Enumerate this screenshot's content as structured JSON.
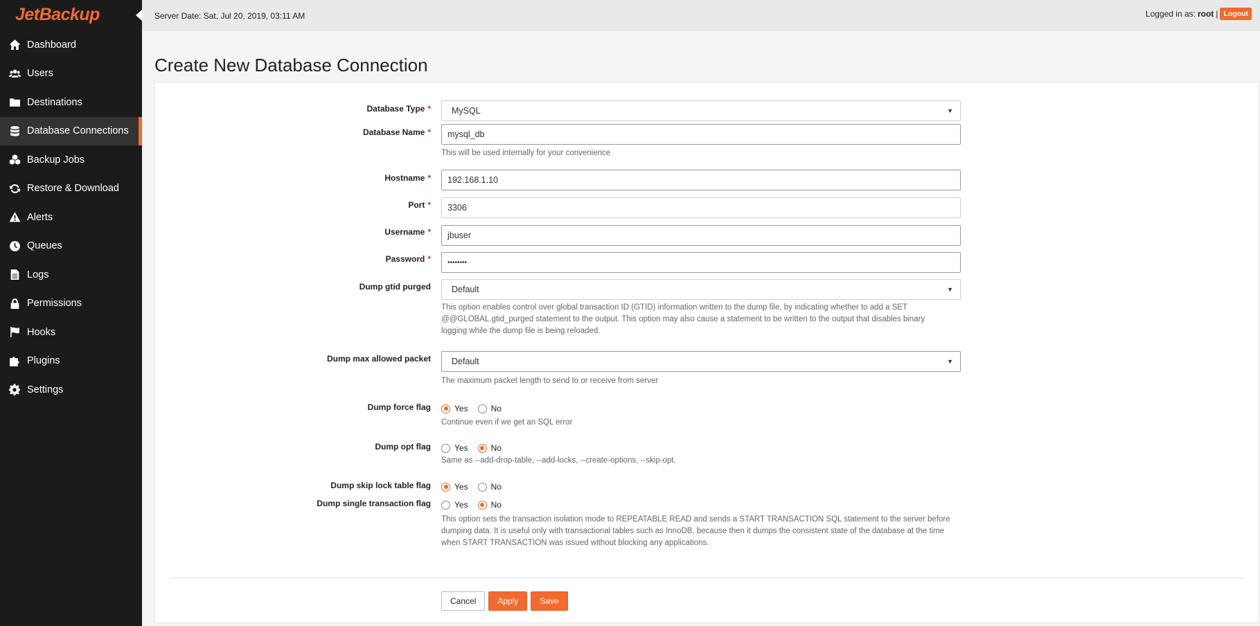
{
  "brand": {
    "name": "JetBackup",
    "accent": "#f26a2e"
  },
  "sidebar": {
    "items": [
      {
        "label": "Dashboard",
        "icon": "home-icon"
      },
      {
        "label": "Users",
        "icon": "users-icon"
      },
      {
        "label": "Destinations",
        "icon": "folder-icon"
      },
      {
        "label": "Database Connections",
        "icon": "database-icon",
        "active": true
      },
      {
        "label": "Backup Jobs",
        "icon": "cubes-icon"
      },
      {
        "label": "Restore & Download",
        "icon": "refresh-icon"
      },
      {
        "label": "Alerts",
        "icon": "warning-icon"
      },
      {
        "label": "Queues",
        "icon": "clock-icon"
      },
      {
        "label": "Logs",
        "icon": "file-icon"
      },
      {
        "label": "Permissions",
        "icon": "lock-icon"
      },
      {
        "label": "Hooks",
        "icon": "flag-icon"
      },
      {
        "label": "Plugins",
        "icon": "puzzle-icon"
      },
      {
        "label": "Settings",
        "icon": "gear-icon"
      }
    ]
  },
  "header": {
    "server_date": "Server Date: Sat, Jul 20, 2019, 03:11 AM",
    "logged_in_prefix": "Logged in as:",
    "username": "root",
    "separator": "|",
    "logout_label": "Logout"
  },
  "page": {
    "title": "Create New Database Connection"
  },
  "form": {
    "database_type": {
      "label": "Database Type",
      "value": "MySQL"
    },
    "database_name": {
      "label": "Database Name",
      "value": "mysql_db",
      "help": "This will be used internally for your convenience"
    },
    "hostname": {
      "label": "Hostname",
      "value": "192.168.1.10"
    },
    "port": {
      "label": "Port",
      "value": "3306"
    },
    "username": {
      "label": "Username",
      "value": "jbuser"
    },
    "password": {
      "label": "Password",
      "value": "••••••••"
    },
    "dump_gtid_purged": {
      "label": "Dump gtid purged",
      "value": "Default",
      "help_1": "This option enables control over global transaction ID (GTID) information written to the dump file, by indicating whether to add a SET",
      "help_2": "@@GLOBAL.gtid_purged statement to the output. This option may also cause a statement to be written to the output that disables binary",
      "help_3": "logging while the dump file is being reloaded."
    },
    "dump_max_allowed_packet": {
      "label": "Dump max allowed packet",
      "value": "Default",
      "help": "The maximum packet length to send to or receive from server"
    },
    "dump_force_flag": {
      "label": "Dump force flag",
      "selected": "Yes",
      "help": "Continue even if we get an SQL error"
    },
    "dump_opt_flag": {
      "label": "Dump opt flag",
      "selected": "No",
      "help": "Same as --add-drop-table, --add-locks, --create-options, --skip-opt."
    },
    "dump_skip_lock_table_flag": {
      "label": "Dump skip lock table flag",
      "selected": "Yes"
    },
    "dump_single_transaction_flag": {
      "label": "Dump single transaction flag",
      "selected": "No",
      "help_1": "This option sets the transaction isolation mode to REPEATABLE READ and sends a START TRANSACTION SQL statement to the server before",
      "help_2": "dumping data. It is useful only with transactional tables such as InnoDB, because then it dumps the consistent state of the database at the time",
      "help_3": "when START TRANSACTION was issued without blocking any applications."
    },
    "yes_label": "Yes",
    "no_label": "No",
    "required_mark": "*"
  },
  "actions": {
    "cancel": "Cancel",
    "apply": "Apply",
    "save": "Save"
  }
}
